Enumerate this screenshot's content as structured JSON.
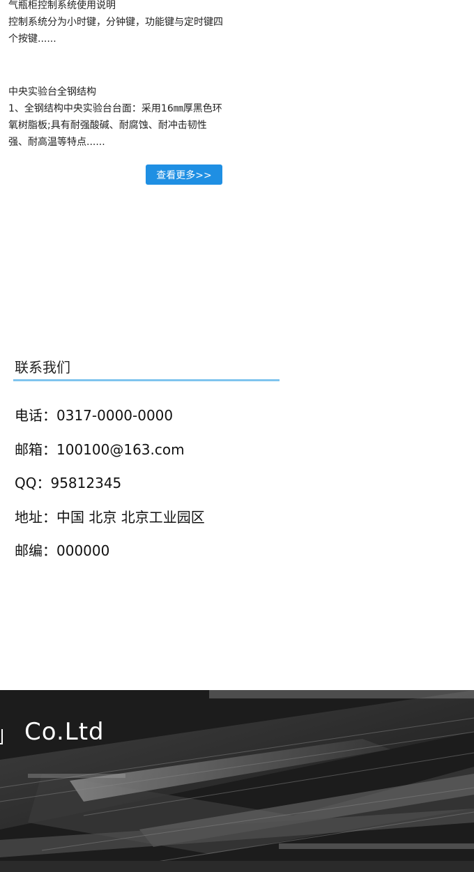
{
  "news": [
    {
      "title": "气瓶柜控制系统使用说明",
      "desc": "控制系统分为小时键，分钟键，功能键与定时键四个按键......"
    },
    {
      "title": "中央实验台全钢结构",
      "desc": "1、全钢结构中央实验台台面：采用16㎜厚黑色环氧树脂板;具有耐强酸碱、耐腐蚀、耐冲击韧性强、耐高温等特点......"
    }
  ],
  "more_button": "查看更多>>",
  "contact": {
    "title": "联系我们",
    "items": [
      "电话：0317-0000-0000",
      "邮箱：100100@163.com",
      "QQ：95812345",
      "地址：中国 北京 北京工业园区",
      "邮编：000000"
    ]
  },
  "footer": {
    "company_text": "Co.Ltd"
  },
  "colors": {
    "accent": "#1f8fe3",
    "underline": "#7fc4ee",
    "footer_bg": "#1a1a1a"
  }
}
